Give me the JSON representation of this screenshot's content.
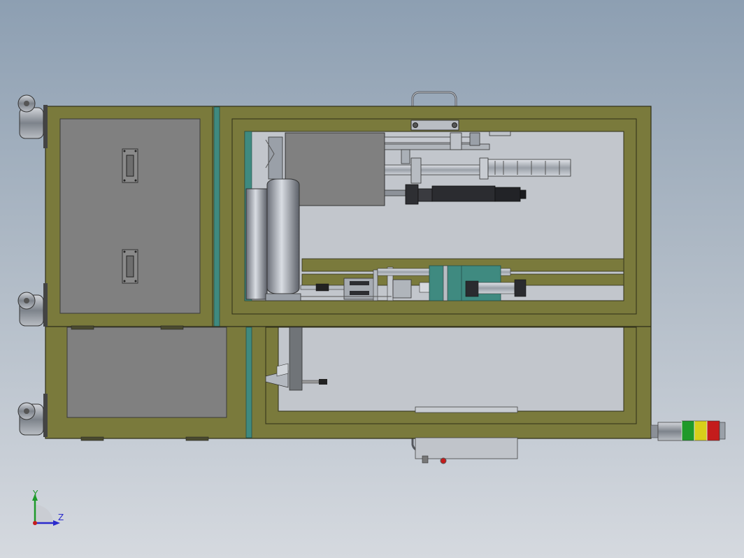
{
  "triad": {
    "y_label": "Y",
    "z_label": "Z"
  },
  "colors": {
    "frame": "#7a7a3c",
    "frame_dark": "#4e4e22",
    "panel": "#808080",
    "teal_bar": "#3f8a80",
    "stack_green": "#1f9a2a",
    "stack_yellow": "#d8cf1a",
    "stack_red": "#c41c1c"
  }
}
